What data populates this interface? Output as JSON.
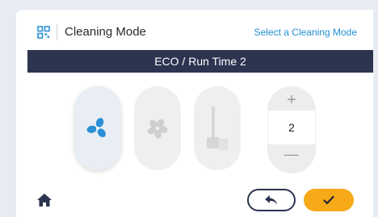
{
  "header": {
    "title": "Cleaning Mode",
    "link": "Select a Cleaning Mode",
    "icon": "grid-icon"
  },
  "banner": {
    "text": "ECO / Run Time 2"
  },
  "modes": [
    {
      "icon": "fan-icon",
      "state": "selected",
      "color": "#2b8fd6"
    },
    {
      "icon": "fan-icon",
      "state": "disabled",
      "color": "#cfcfcf"
    },
    {
      "icon": "mop-bucket-icon",
      "state": "disabled",
      "color": "#d6d6d6"
    }
  ],
  "stepper": {
    "plus": "+",
    "value": "2",
    "minus": "—"
  },
  "footer": {
    "home_icon": "home-icon",
    "back_icon": "back-arrow-icon",
    "confirm_icon": "check-icon",
    "confirm_color": "#f7aa18"
  }
}
